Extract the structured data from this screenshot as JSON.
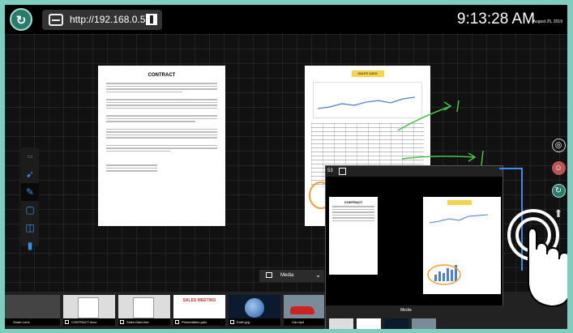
{
  "header": {
    "url": "http://192.168.0.53",
    "time": "9:13:28 AM",
    "date": "August 25, 2019"
  },
  "canvas": {
    "doc1_title": "CONTRACT",
    "doc2_title": "SALES DATA"
  },
  "toolbar": {
    "items": [
      {
        "icon": "select-icon"
      },
      {
        "icon": "pointer-icon"
      },
      {
        "icon": "pen-icon"
      },
      {
        "icon": "document-icon"
      },
      {
        "icon": "annotate-icon"
      },
      {
        "icon": "trash-icon"
      }
    ]
  },
  "media_bar": {
    "label": "Media"
  },
  "strip": {
    "thumbs": [
      {
        "caption": "Smart Lens"
      },
      {
        "caption": "CONTRACT.docx"
      },
      {
        "caption": "Sales Data.xlsx"
      },
      {
        "caption": "Presentation.pptx"
      },
      {
        "caption": "Earth.jpg"
      },
      {
        "caption": "Car.mp4"
      }
    ],
    "slide_title": "SALES MEETING"
  },
  "overlay": {
    "number": "53",
    "doc1_title": "CONTRACT",
    "media_label": "Media"
  },
  "colors": {
    "background": "#7fcdbf",
    "accent_blue": "#3b8ee8",
    "annotation_green": "#44c44a",
    "annotation_orange": "#f0a030"
  }
}
